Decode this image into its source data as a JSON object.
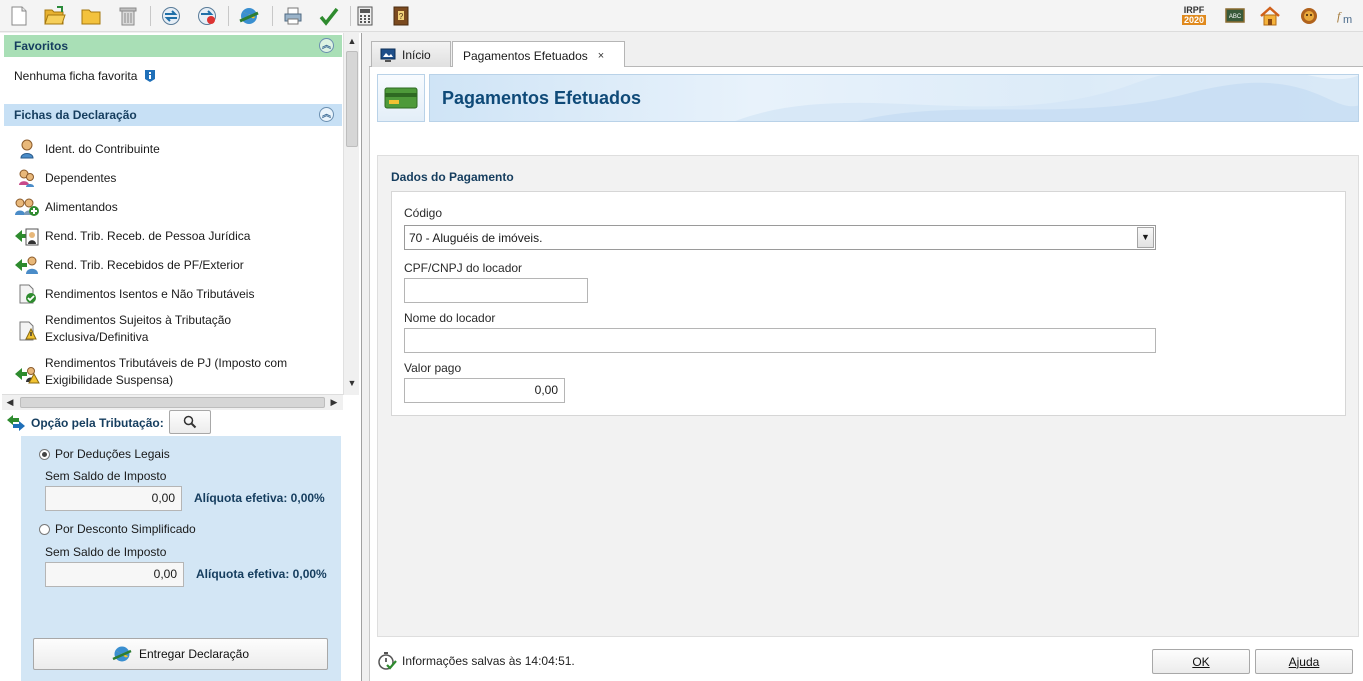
{
  "toolbar": {
    "left_icons": [
      "new-file-icon",
      "open-folder-icon",
      "folder-icon",
      "trash-icon",
      "import-icon",
      "recover-icon",
      "transmit-icon",
      "print-icon",
      "check-icon",
      "calculator-icon",
      "book-icon"
    ],
    "right_badge": "IRPF",
    "right_year": "2020",
    "right_abc": "ABC"
  },
  "sidebar": {
    "favoritos": {
      "title": "Favoritos",
      "empty_text": "Nenhuma ficha favorita"
    },
    "fichas": {
      "title": "Fichas da Declaração",
      "items": [
        {
          "label": "Ident. do Contribuinte"
        },
        {
          "label": "Dependentes"
        },
        {
          "label": "Alimentandos"
        },
        {
          "label": "Rend. Trib. Receb. de Pessoa Jurídica"
        },
        {
          "label": "Rend. Trib. Recebidos de PF/Exterior"
        },
        {
          "label": "Rendimentos Isentos e Não Tributáveis"
        },
        {
          "label": "Rendimentos Sujeitos à Tributação Exclusiva/Definitiva"
        },
        {
          "label": "Rendimentos Tributáveis de PJ (Imposto com Exigibilidade Suspensa)"
        }
      ]
    },
    "opcao": {
      "title": "Opção pela Tributação:",
      "deducoes_label": "Por Deduções Legais",
      "deducoes_saldo_label": "Sem Saldo de Imposto",
      "deducoes_value": "0,00",
      "deducoes_aliquota": "Alíquota efetiva: 0,00%",
      "simplificado_label": "Por Desconto Simplificado",
      "simplificado_saldo_label": "Sem Saldo de Imposto",
      "simplificado_value": "0,00",
      "simplificado_aliquota": "Alíquota efetiva: 0,00%",
      "selected": "deducoes"
    },
    "entregar_label": "Entregar Declaração"
  },
  "tabs": [
    {
      "label": "Início",
      "active": false
    },
    {
      "label": "Pagamentos Efetuados",
      "active": true,
      "close": "×"
    }
  ],
  "page": {
    "title": "Pagamentos Efetuados",
    "section_title": "Dados do Pagamento",
    "codigo_label": "Código",
    "codigo_value": "70 - Aluguéis de imóveis.",
    "cpf_label": "CPF/CNPJ do locador",
    "cpf_value": "",
    "nome_label": "Nome do locador",
    "nome_value": "",
    "valor_label": "Valor pago",
    "valor_value": "0,00"
  },
  "footer": {
    "status_text": "Informações salvas às 14:04:51.",
    "ok_label": "OK",
    "ajuda_label": "Ajuda"
  },
  "colors": {
    "favoritos_header": "#a9dfb6",
    "fichas_header": "#c7e0f5",
    "title_blue": "#0f4a78",
    "opcao_bg": "#d3e6f5"
  }
}
